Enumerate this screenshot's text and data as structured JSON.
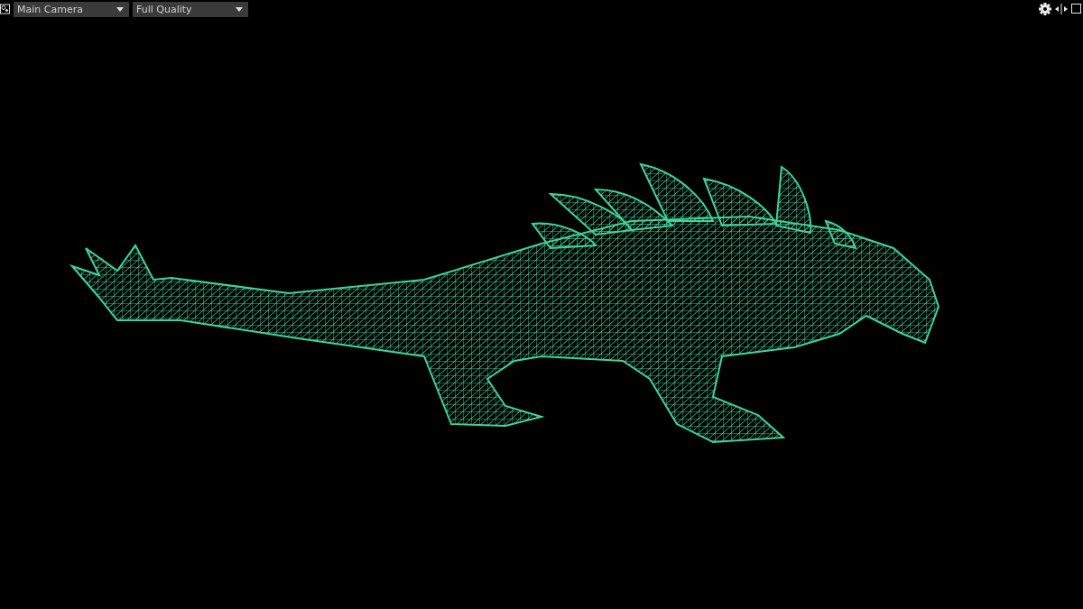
{
  "toolbar": {
    "dropdowns": [
      {
        "value": "Main Camera"
      },
      {
        "value": "Full Quality"
      }
    ]
  }
}
